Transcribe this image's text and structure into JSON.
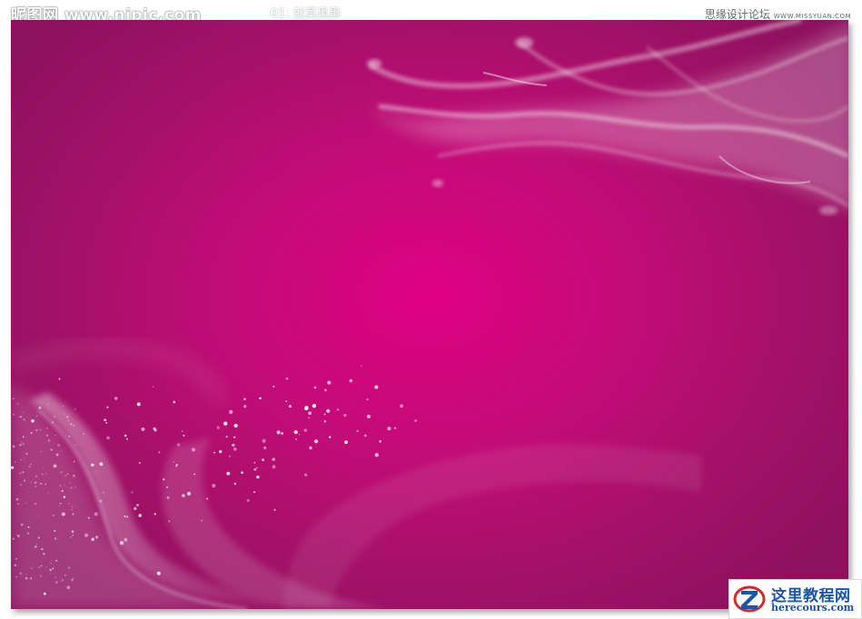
{
  "watermarks": {
    "top_left": "昵图网 www.nipic.com",
    "top_center": "01: 就莫黑黑",
    "top_right_cn": "思缘设计论坛",
    "top_right_en": "WWW.MISSYUAN.COM"
  },
  "badge": {
    "title": "这里教程网",
    "subtitle": "herecours.com"
  },
  "colors": {
    "background_center": "#df0083",
    "background_edge": "#8e1160",
    "smoke": "#ffffff",
    "badge_text": "#1b55a6",
    "badge_ring": "#d32a2a"
  },
  "icons": {
    "badge_logo": "z-logo-icon"
  }
}
